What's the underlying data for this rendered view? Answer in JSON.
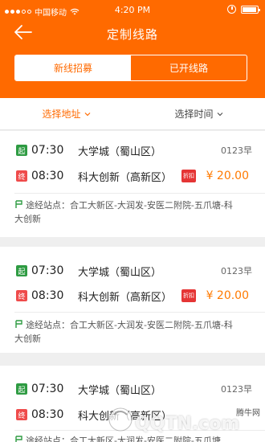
{
  "status_bar": {
    "carrier": "中国移动",
    "time": "4:20 PM"
  },
  "header": {
    "title": "定制线路"
  },
  "tabs": [
    {
      "label": "新线招募"
    },
    {
      "label": "已开线路"
    }
  ],
  "filters": {
    "address": "选择地址",
    "time": "选择时间"
  },
  "routes": [
    {
      "start_tag": "起",
      "start_time": "07:30",
      "start_place": "大学城（蜀山区）",
      "code": "0123早",
      "end_tag": "终",
      "end_time": "08:30",
      "end_place": "科大创新（高新区）",
      "discount_badge": "折扣",
      "price": "¥ 20.00",
      "stops_label": "途经站点：",
      "stops": "合工大新区-大润发-安医二附院-五爪塘-科大创新"
    },
    {
      "start_tag": "起",
      "start_time": "07:30",
      "start_place": "大学城（蜀山区）",
      "code": "0123早",
      "end_tag": "终",
      "end_time": "08:30",
      "end_place": "科大创新（高新区）",
      "discount_badge": "折扣",
      "price": "¥ 20.00",
      "stops_label": "途经站点：",
      "stops": "合工大新区-大润发-安医二附院-五爪塘-科大创新"
    },
    {
      "start_tag": "起",
      "start_time": "07:30",
      "start_place": "大学城（蜀山区）",
      "code": "0123早",
      "end_tag": "终",
      "end_time": "08:30",
      "end_place": "科大创新（高新区）",
      "stops_label": "途经站点：",
      "stops": "合工大新区-大润发-安医二附院-五爪塘"
    }
  ],
  "watermark": {
    "small": "腾牛网",
    "big": "QQTN.com"
  },
  "colors": {
    "accent": "#ff6a00",
    "start_tag": "#2e9b42",
    "end_tag": "#ef4b4b",
    "price": "#ff7a00"
  }
}
